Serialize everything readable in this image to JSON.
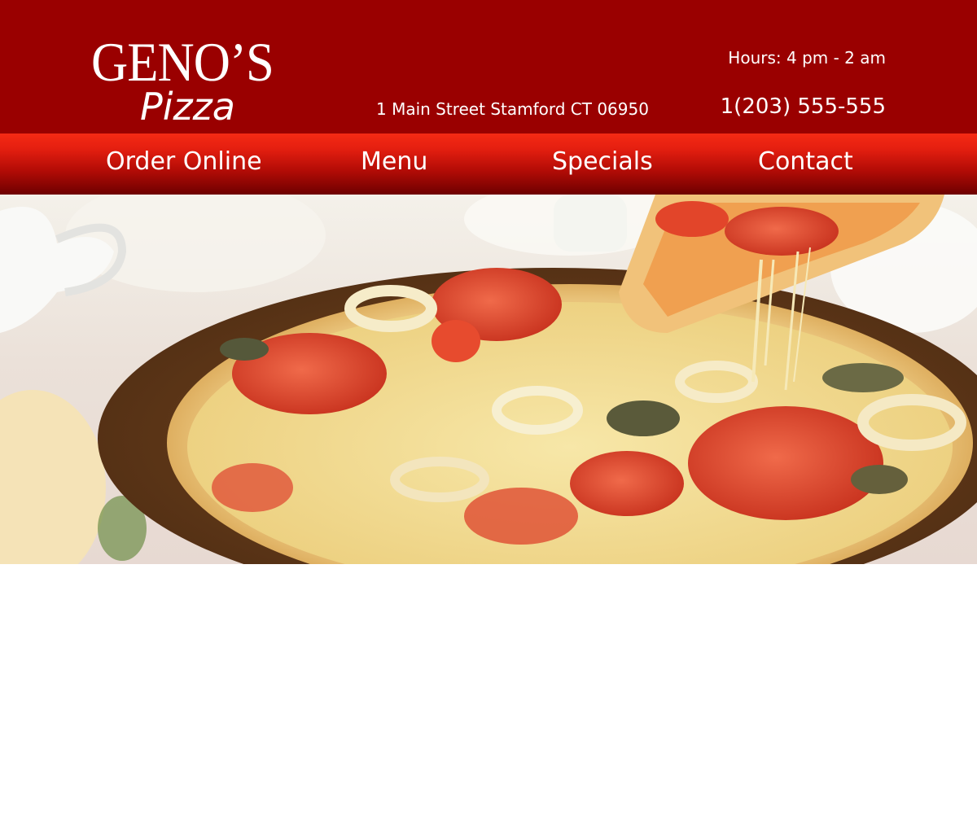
{
  "brand": {
    "name_main": "GENO’S",
    "name_sub": "Pizza"
  },
  "contact": {
    "address": "1 Main Street Stamford CT 06950",
    "hours": "Hours: 4 pm - 2 am",
    "phone": "1(203) 555-555"
  },
  "nav": {
    "items": [
      {
        "label": "Order Online"
      },
      {
        "label": "Menu"
      },
      {
        "label": "Specials"
      },
      {
        "label": "Contact"
      }
    ]
  },
  "hero": {
    "image_alt": ""
  },
  "colors": {
    "header_bg": "#9a0000",
    "nav_top": "#f52a14",
    "nav_bottom": "#6e0000",
    "text": "#ffffff"
  }
}
